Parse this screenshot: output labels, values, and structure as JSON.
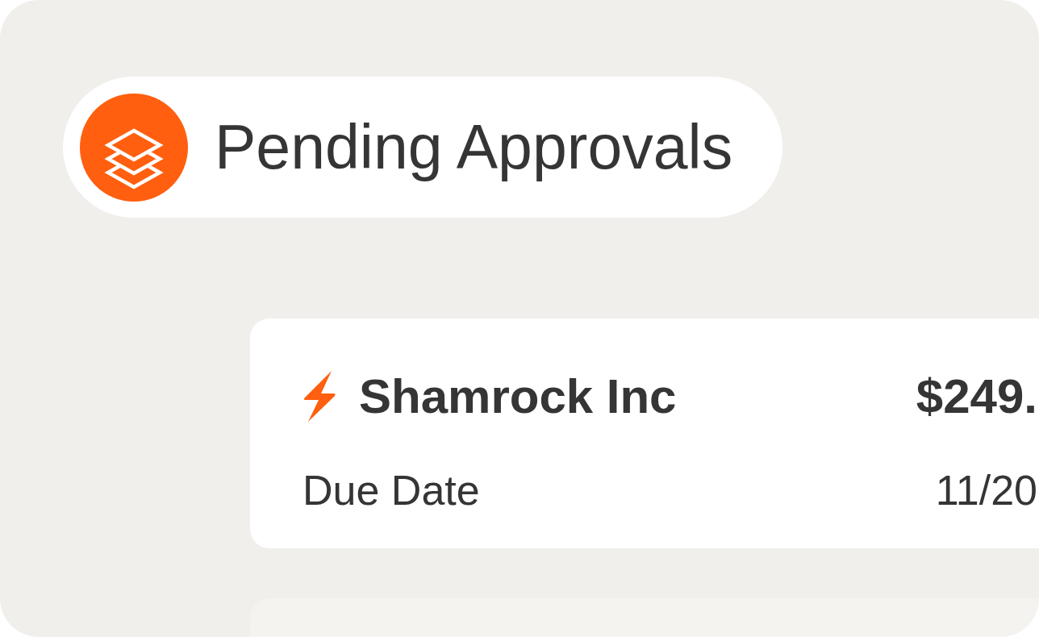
{
  "header": {
    "title": "Pending Approvals"
  },
  "approvals": [
    {
      "vendor": "Shamrock Inc",
      "amount": "$249.",
      "field_label": "Due Date",
      "field_value": "11/20"
    }
  ]
}
